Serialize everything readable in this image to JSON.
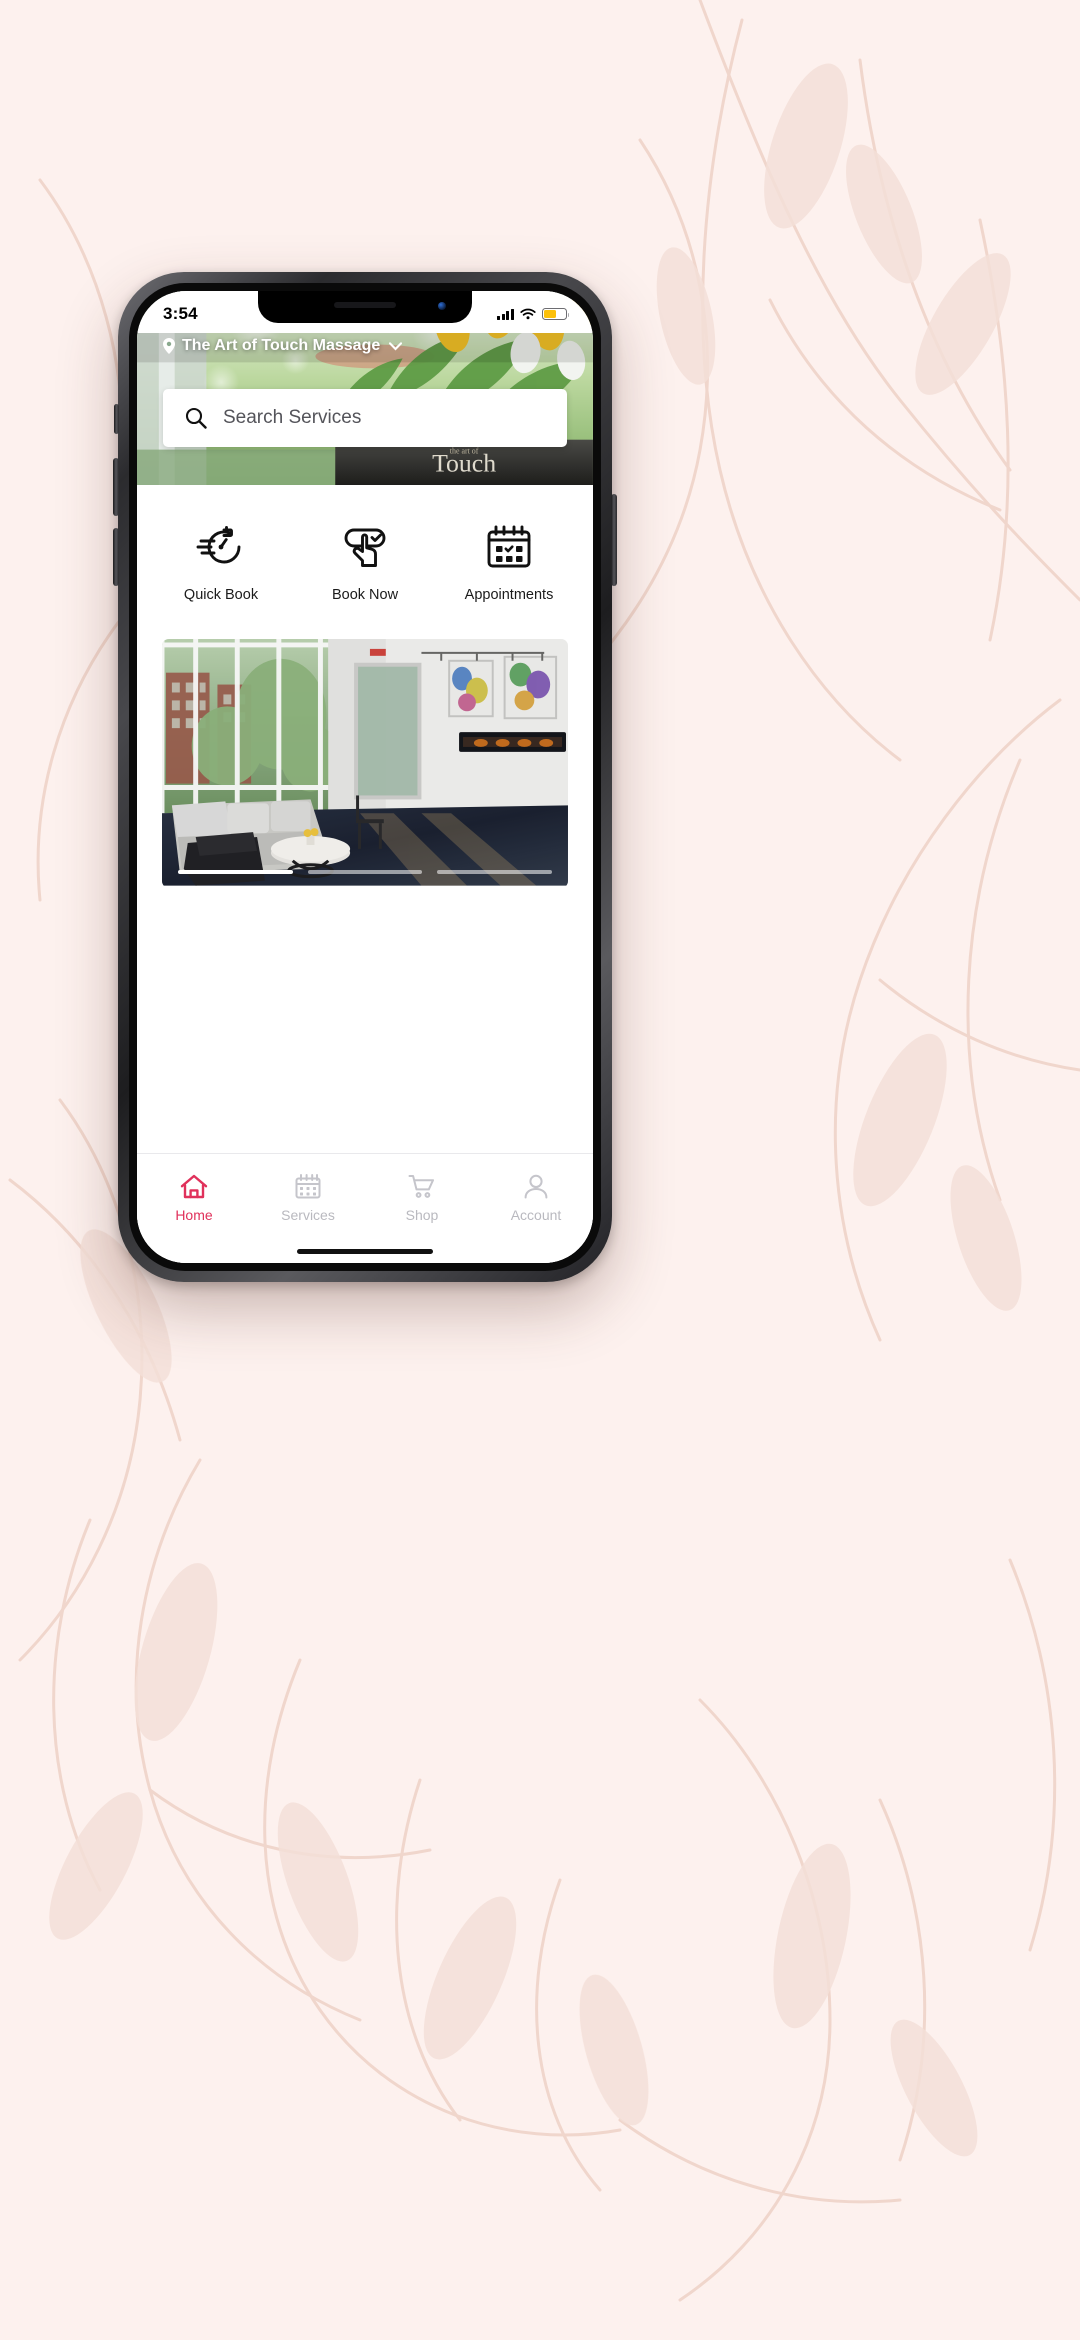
{
  "page": {
    "background_color": "#FDF1EE",
    "accent_color": "#E0315B",
    "inactive_color": "#B9B9BF"
  },
  "status_bar": {
    "time": "3:54",
    "signal_icon": "cellular-signal-icon",
    "wifi_icon": "wifi-icon",
    "battery_icon": "battery-icon",
    "battery_color": "#FCC00A",
    "battery_level_percent": 55
  },
  "header": {
    "location_pin_icon": "location-pin-icon",
    "business_name": "The Art of Touch Massage",
    "chevron_icon": "chevron-down-icon",
    "hero_image_alt": "tulip bouquet in window"
  },
  "search": {
    "icon": "search-icon",
    "placeholder": "Search Services",
    "value": ""
  },
  "quick_actions": [
    {
      "id": "quick-book",
      "label": "Quick Book",
      "icon": "stopwatch-icon"
    },
    {
      "id": "book-now",
      "label": "Book Now",
      "icon": "tap-button-icon"
    },
    {
      "id": "appointments",
      "label": "Appointments",
      "icon": "calendar-check-icon"
    }
  ],
  "carousel": {
    "image_alt": "modern lounge interior with sofa and fireplace",
    "slide_count": 3,
    "active_slide": 1
  },
  "tabbar": [
    {
      "id": "home",
      "label": "Home",
      "icon": "home-icon",
      "active": true
    },
    {
      "id": "services",
      "label": "Services",
      "icon": "calendar-icon",
      "active": false
    },
    {
      "id": "shop",
      "label": "Shop",
      "icon": "cart-icon",
      "active": false
    },
    {
      "id": "account",
      "label": "Account",
      "icon": "person-icon",
      "active": false
    }
  ]
}
